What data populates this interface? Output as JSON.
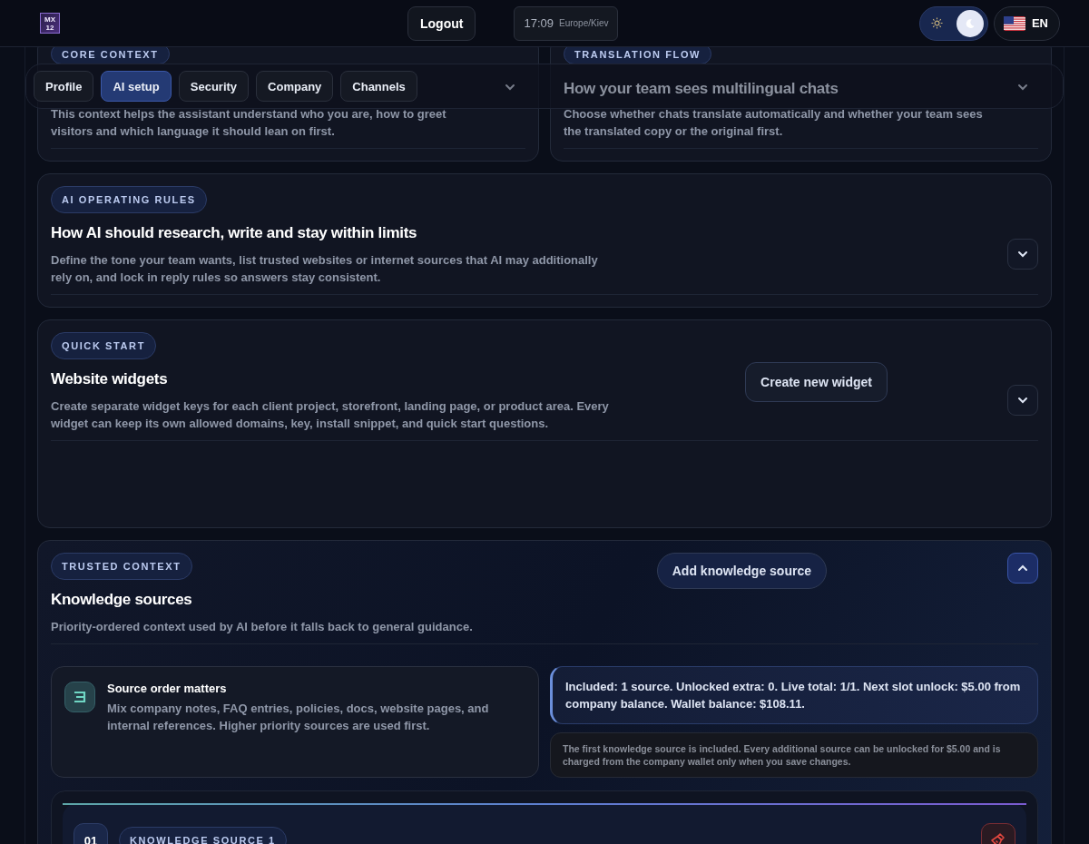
{
  "header": {
    "logo": [
      "MX",
      "12"
    ],
    "logout": "Logout",
    "clock": {
      "time": "17:09",
      "zone": "Europe/Kiev"
    },
    "theme_toggle": {
      "dark": true
    },
    "language": "EN"
  },
  "tabs": [
    {
      "label": "Profile",
      "selected": false
    },
    {
      "label": "AI setup",
      "selected": true
    },
    {
      "label": "Security",
      "selected": false
    },
    {
      "label": "Company",
      "selected": false
    },
    {
      "label": "Channels",
      "selected": false
    }
  ],
  "top_cards": [
    {
      "badge": "CORE CONTEXT",
      "description": "This context helps the assistant understand who you are, how to greet visitors and which language it should lean on first.",
      "expanded": false
    },
    {
      "badge": "TRANSLATION FLOW",
      "title": "How your team sees multilingual chats",
      "description": "Choose whether chats translate automatically and whether your team sees the translated copy or the original first.",
      "expanded": false
    }
  ],
  "sections": [
    {
      "badge": "AI OPERATING RULES",
      "title": "How AI should research, write and stay within limits",
      "description": "Define the tone your team wants, list trusted websites or internet sources that AI may additionally rely on, and lock in reply rules so answers stay consistent.",
      "expanded": false
    },
    {
      "badge": "QUICK START",
      "title": "Website widgets",
      "description": "Create separate widget keys for each client project, storefront, landing page, or product area. Every widget can keep its own allowed domains, key, install snippet, and quick start questions.",
      "action": "Create new widget",
      "expanded": false
    },
    {
      "badge": "TRUSTED CONTEXT",
      "title": "Knowledge sources",
      "description": "Priority-ordered context used by AI before it falls back to general guidance.",
      "action": "Add knowledge source",
      "expanded": true
    }
  ],
  "knowledge": {
    "note": {
      "title": "Source order matters",
      "text": "Mix company notes, FAQ entries, policies, docs, website pages, and internal references. Higher priority sources are used first."
    },
    "summary": "Included: 1 source. Unlocked extra: 0. Live total: 1/1. Next slot unlock: $5.00 from company balance. Wallet balance: $108.11.",
    "fine_print": "The first knowledge source is included. Every additional source can be unlocked for $5.00 and is charged from the company wallet only when you save changes.",
    "sources": [
      {
        "number": "01",
        "label": "KNOWLEDGE SOURCE 1"
      }
    ]
  }
}
